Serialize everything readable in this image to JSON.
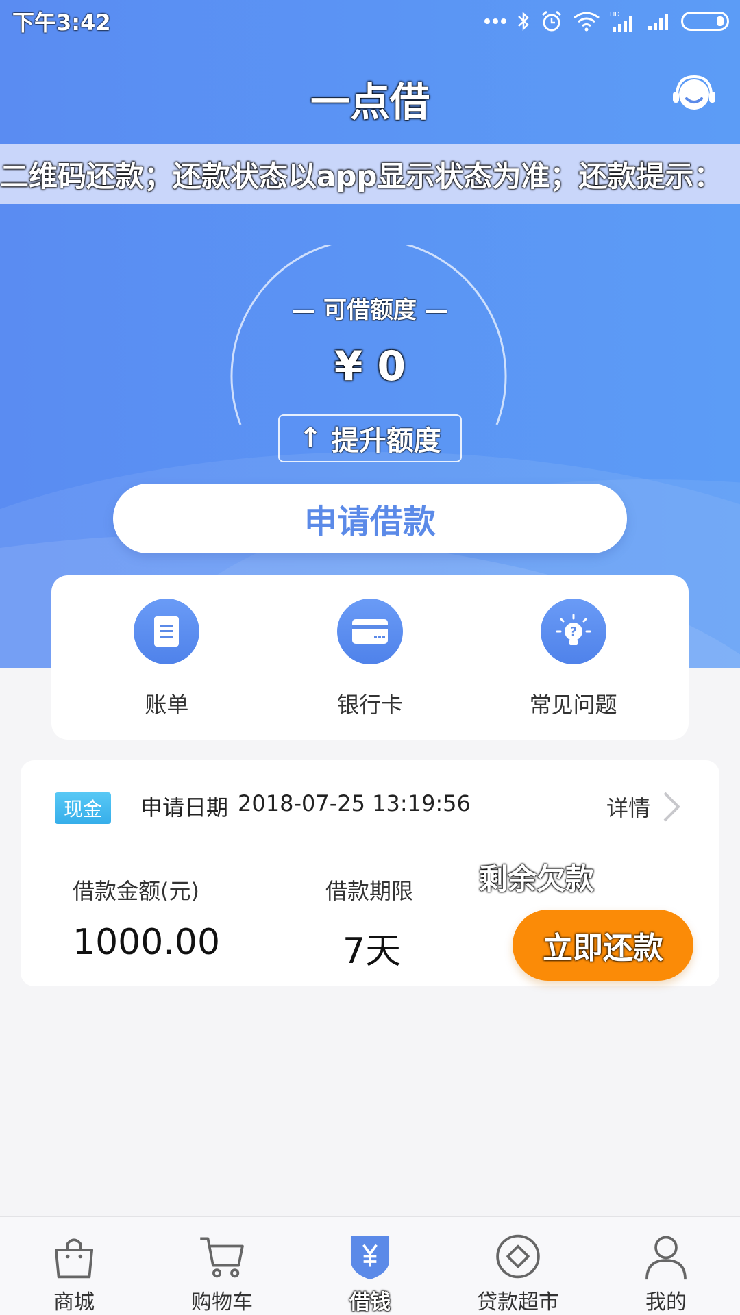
{
  "status_bar": {
    "time": "下午3:42",
    "signal_badge": "HD"
  },
  "header": {
    "title": "一点借"
  },
  "marquee": {
    "text": "二维码还款；还款状态以app显示状态为准；还款提示："
  },
  "credit": {
    "label": "— 可借额度 —",
    "amount": "¥ 0",
    "raise_arrow": "↑",
    "raise_label": "提升额度",
    "apply_label": "申请借款"
  },
  "quick_actions": [
    {
      "label": "账单",
      "icon": "bill-icon"
    },
    {
      "label": "银行卡",
      "icon": "bank-card-icon"
    },
    {
      "label": "常见问题",
      "icon": "lightbulb-question-icon"
    }
  ],
  "loan": {
    "badge": "现金",
    "date_label": "申请日期",
    "date_value": "2018-07-25 13:19:56",
    "detail_label": "详情",
    "amount_label": "借款金额(元)",
    "amount_value": "1000.00",
    "term_label": "借款期限",
    "term_value": "7天",
    "remaining_label": "剩余欠款",
    "repay_label": "立即还款"
  },
  "bottom_nav": [
    {
      "label": "商城",
      "icon": "shopping-bag-icon",
      "active": false
    },
    {
      "label": "购物车",
      "icon": "cart-icon",
      "active": false
    },
    {
      "label": "借钱",
      "icon": "yuan-shield-icon",
      "active": true
    },
    {
      "label": "贷款超市",
      "icon": "diamond-circle-icon",
      "active": false
    },
    {
      "label": "我的",
      "icon": "user-icon",
      "active": false
    }
  ],
  "colors": {
    "primary": "#5b8ae8",
    "marquee_bg": "#c9d6fa",
    "badge": "#36aeea",
    "repay": "#fb8b07"
  }
}
